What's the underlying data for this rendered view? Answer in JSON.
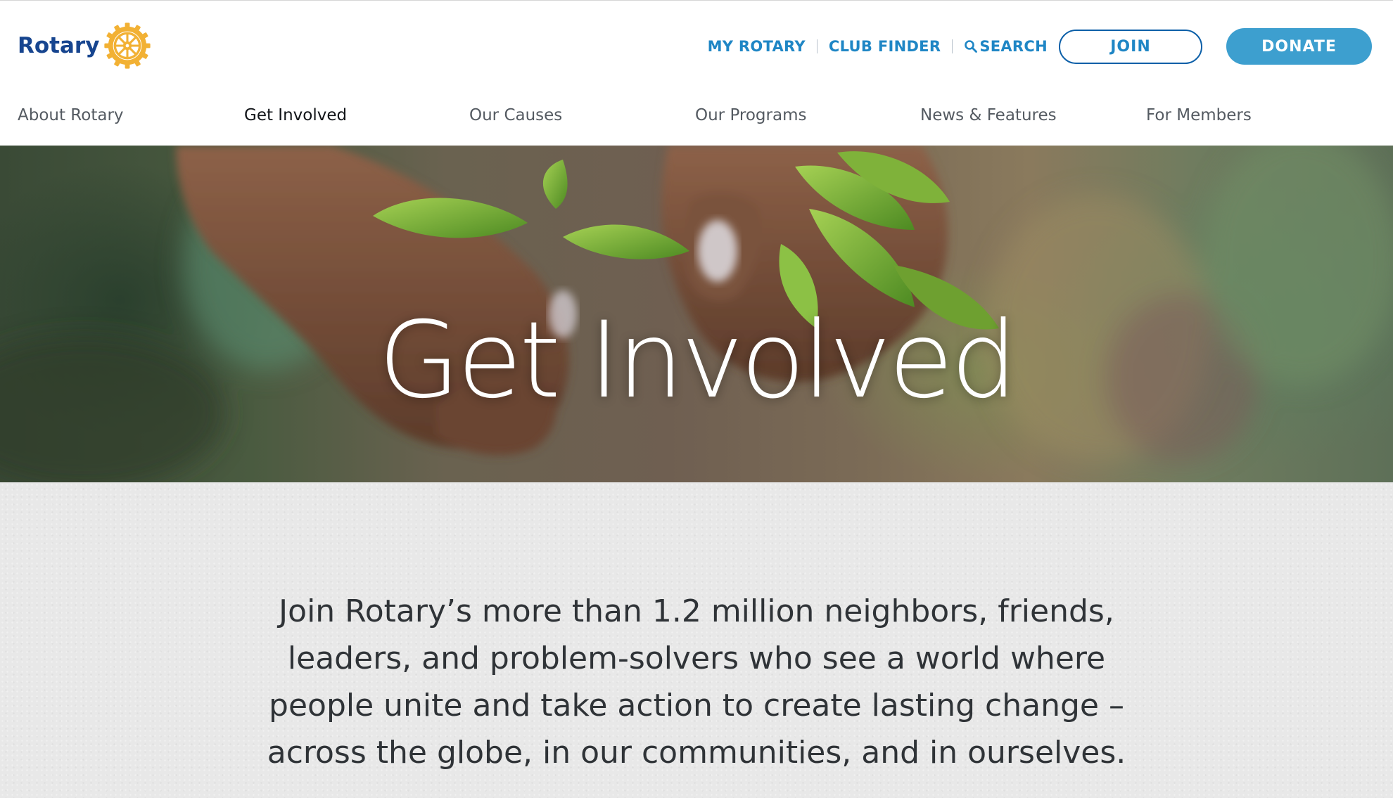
{
  "brand": {
    "name": "Rotary",
    "logo_icon": "rotary-wheel-icon",
    "wheel_color": "#f2b134",
    "word_color": "#17458f"
  },
  "utility_nav": {
    "my_rotary": "MY ROTARY",
    "club_finder": "CLUB FINDER",
    "search": "SEARCH",
    "search_icon": "search-icon",
    "join": "JOIN",
    "donate": "DONATE"
  },
  "main_nav": {
    "items": [
      {
        "label": "About Rotary",
        "active": false
      },
      {
        "label": "Get Involved",
        "active": true
      },
      {
        "label": "Our Causes",
        "active": false
      },
      {
        "label": "Our Programs",
        "active": false
      },
      {
        "label": "News & Features",
        "active": false
      },
      {
        "label": "For Members",
        "active": false
      }
    ]
  },
  "hero": {
    "title": "Get Involved"
  },
  "intro": {
    "lines": [
      "Join Rotary’s more than 1.2 million neighbors, friends,",
      "leaders, and problem-solvers who see a world where",
      "people unite and take action to create lasting change –",
      "across the globe, in our communities, and in ourselves."
    ]
  },
  "colors": {
    "link_blue": "#1f86c5",
    "join_border": "#0b5fa8",
    "donate_bg": "#3d9fcf",
    "intro_bg": "#e8e8e8"
  }
}
